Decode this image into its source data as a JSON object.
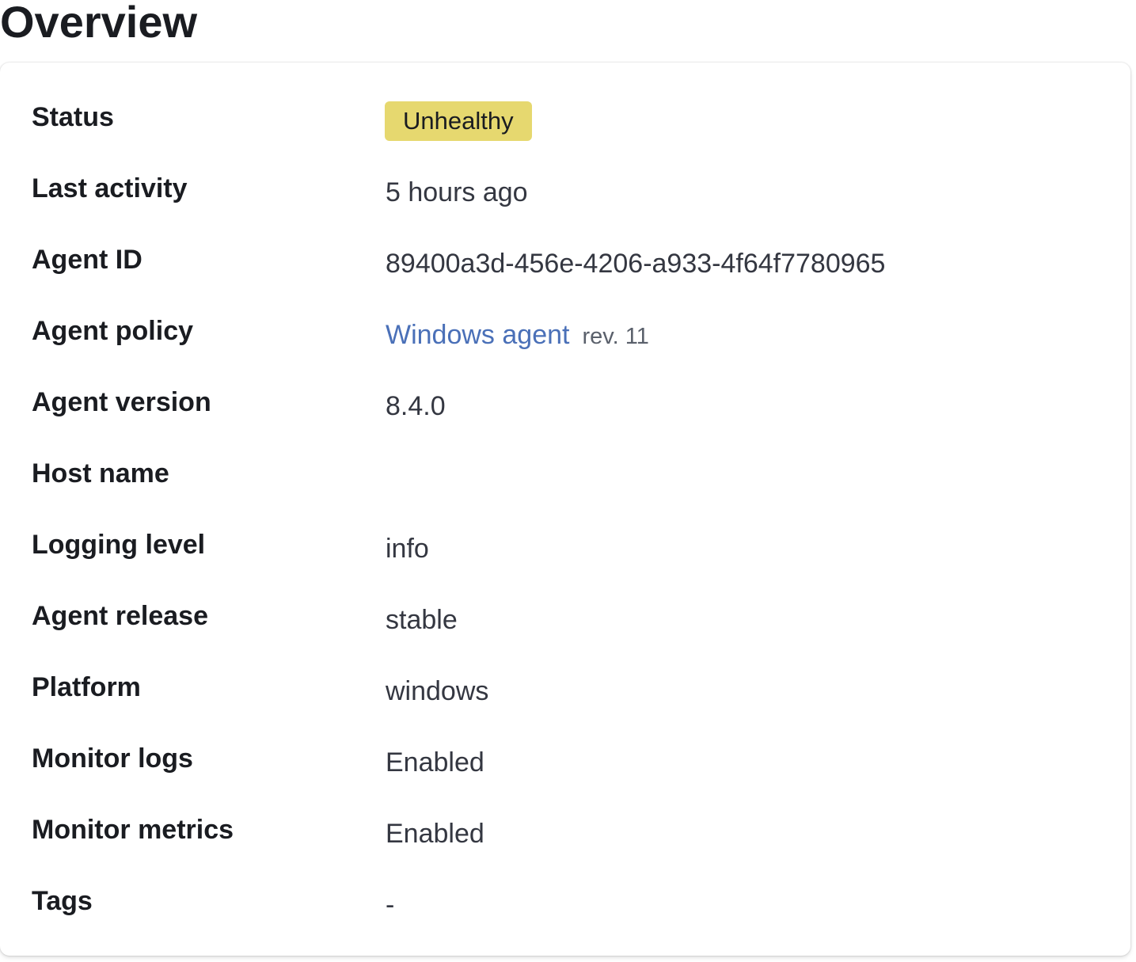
{
  "page": {
    "title": "Overview"
  },
  "status_badge_color": "#e6d86f",
  "link_color": "#4a70b8",
  "rows": {
    "status": {
      "label": "Status",
      "value": "Unhealthy"
    },
    "last_activity": {
      "label": "Last activity",
      "value": "5 hours ago"
    },
    "agent_id": {
      "label": "Agent ID",
      "value": "89400a3d-456e-4206-a933-4f64f7780965"
    },
    "agent_policy": {
      "label": "Agent policy",
      "value": "Windows agent",
      "revision": "rev. 11"
    },
    "agent_version": {
      "label": "Agent version",
      "value": "8.4.0"
    },
    "host_name": {
      "label": "Host name",
      "value": ""
    },
    "logging_level": {
      "label": "Logging level",
      "value": "info"
    },
    "agent_release": {
      "label": "Agent release",
      "value": "stable"
    },
    "platform": {
      "label": "Platform",
      "value": "windows"
    },
    "monitor_logs": {
      "label": "Monitor logs",
      "value": "Enabled"
    },
    "monitor_metrics": {
      "label": "Monitor metrics",
      "value": "Enabled"
    },
    "tags": {
      "label": "Tags",
      "value": "-"
    }
  }
}
